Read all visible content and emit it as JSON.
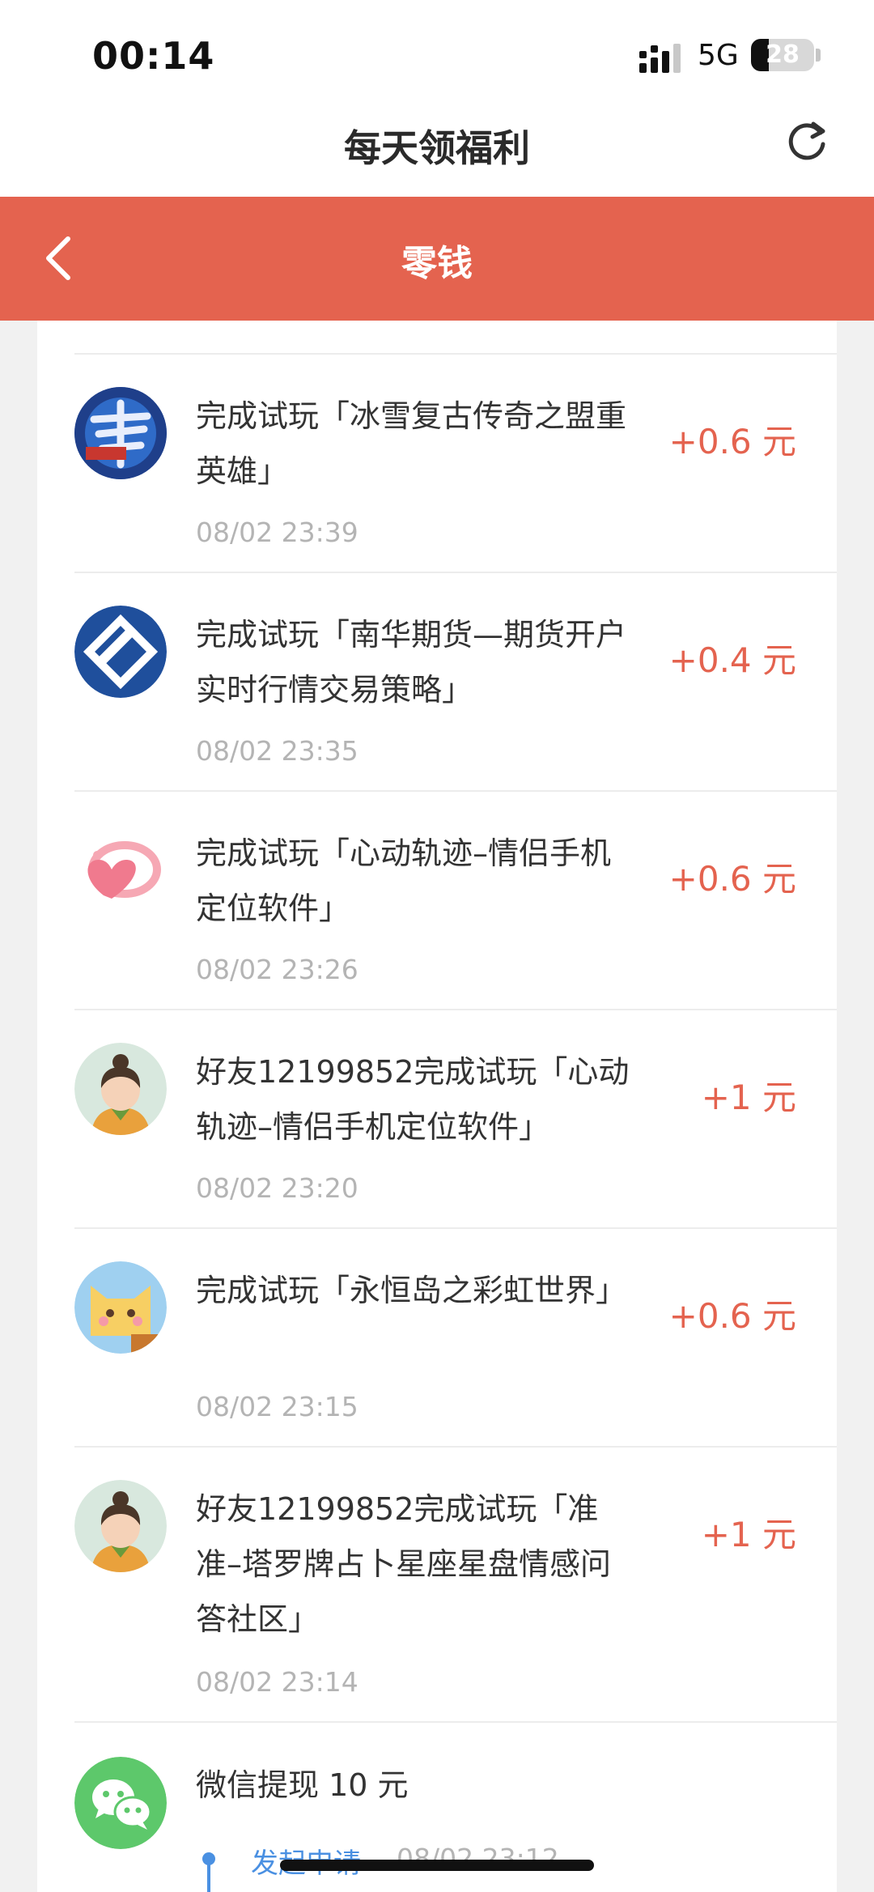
{
  "status_bar": {
    "time": "00:14",
    "network": "5G",
    "battery": "28"
  },
  "header": {
    "title": "每天领福利",
    "refresh_icon": "refresh-icon"
  },
  "nav": {
    "title": "零钱",
    "back_icon": "chevron-left-icon"
  },
  "records": [
    {
      "title": "完成试玩「冰雪复古传奇之盟重英雄」",
      "date": "08/02 23:39",
      "amount": "+0.6 元",
      "icon": "game-dragon-icon"
    },
    {
      "title": "完成试玩「南华期货—期货开户实时行情交易策略」",
      "date": "08/02 23:35",
      "amount": "+0.4 元",
      "icon": "nanhua-futures-icon"
    },
    {
      "title": "完成试玩「心动轨迹–情侣手机定位软件」",
      "date": "08/02 23:26",
      "amount": "+0.6 元",
      "icon": "heart-locator-icon"
    },
    {
      "title": "好友12199852完成试玩「心动轨迹–情侣手机定位软件」",
      "date": "08/02 23:20",
      "amount": "+1 元",
      "icon": "friend-avatar-icon"
    },
    {
      "title": "完成试玩「永恒岛之彩虹世界」",
      "date": "08/02 23:15",
      "amount": "+0.6 元",
      "icon": "cat-game-icon"
    },
    {
      "title": "好友12199852完成试玩「准准–塔罗牌占卜星座星盘情感问答社区」",
      "date": "08/02 23:14",
      "amount": "+1 元",
      "icon": "friend-avatar-icon"
    }
  ],
  "withdrawal": {
    "title": "微信提现  10 元",
    "icon": "wechat-icon",
    "step_label": "发起申请",
    "step_date": "08/02 23:12"
  },
  "colors": {
    "accent": "#e4634f",
    "wechat": "#5dc86b",
    "link": "#4a90e2"
  }
}
